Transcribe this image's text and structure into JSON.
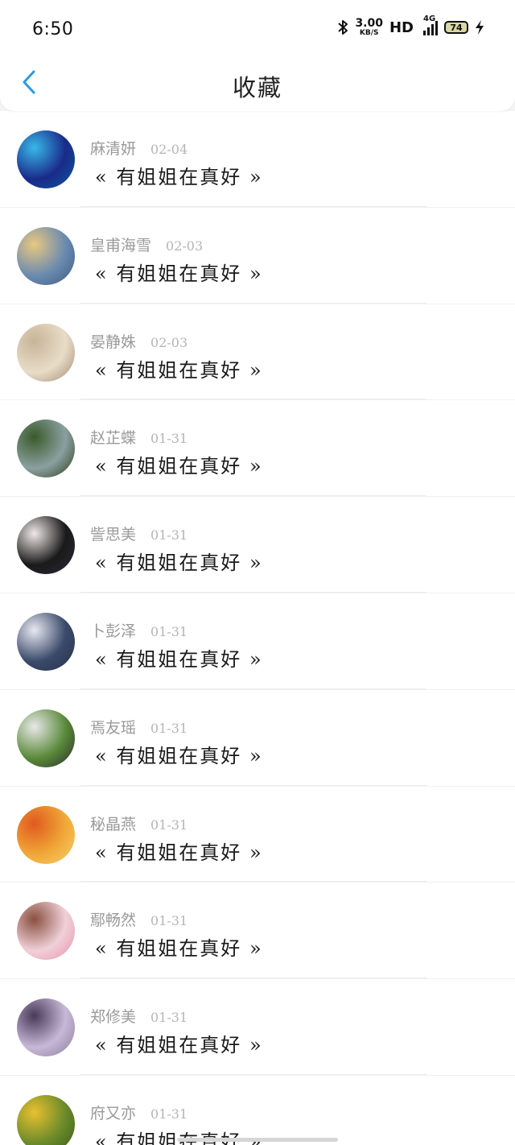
{
  "status_bar": {
    "time": "6:50",
    "speed_value": "3.00",
    "speed_unit": "KB/S",
    "hd": "HD",
    "network": "4G",
    "battery": "74"
  },
  "header": {
    "title": "收藏"
  },
  "items": [
    {
      "name": "麻清妍",
      "date": "02-04",
      "text": "« 有姐姐在真好 »",
      "avatar_colors": [
        "#1a2a8a",
        "#38b8e8",
        "#0a5a9a"
      ]
    },
    {
      "name": "皇甫海雪",
      "date": "02-03",
      "text": "« 有姐姐在真好 »",
      "avatar_colors": [
        "#6a8ab0",
        "#e8c880",
        "#3a5a7a"
      ]
    },
    {
      "name": "晏静姝",
      "date": "02-03",
      "text": "« 有姐姐在真好 »",
      "avatar_colors": [
        "#e8dcc8",
        "#c8b498",
        "#a08a70"
      ]
    },
    {
      "name": "赵芷蝶",
      "date": "01-31",
      "text": "« 有姐姐在真好 »",
      "avatar_colors": [
        "#8aa0a0",
        "#3a5a2a",
        "#2a3a1a"
      ]
    },
    {
      "name": "訾思美",
      "date": "01-31",
      "text": "« 有姐姐在真好 »",
      "avatar_colors": [
        "#1a1a1a",
        "#f0e8e8",
        "#2a2a3a"
      ]
    },
    {
      "name": "卜彭泽",
      "date": "01-31",
      "text": "« 有姐姐在真好 »",
      "avatar_colors": [
        "#3a4a6a",
        "#e8e8f0",
        "#2a3048"
      ]
    },
    {
      "name": "焉友瑶",
      "date": "01-31",
      "text": "« 有姐姐在真好 »",
      "avatar_colors": [
        "#5a8a3a",
        "#e8e8e8",
        "#2a2a2a"
      ]
    },
    {
      "name": "秘晶燕",
      "date": "01-31",
      "text": "« 有姐姐在真好 »",
      "avatar_colors": [
        "#f0a838",
        "#e05a20",
        "#f8d070"
      ]
    },
    {
      "name": "鄢畅然",
      "date": "01-31",
      "text": "« 有姐姐在真好 »",
      "avatar_colors": [
        "#f0d0d8",
        "#8a5040",
        "#e890b0"
      ]
    },
    {
      "name": "郑修美",
      "date": "01-31",
      "text": "« 有姐姐在真好 »",
      "avatar_colors": [
        "#c8b8d8",
        "#4a3a5a",
        "#8a7a9a"
      ]
    },
    {
      "name": "府又亦",
      "date": "01-31",
      "text": "« 有姐姐在真好 »",
      "avatar_colors": [
        "#6a8a2a",
        "#e8c030",
        "#3a5a1a"
      ]
    }
  ],
  "colors": {
    "accent": "#2a9ae8"
  },
  "icons": {
    "back": "chevron-left-icon",
    "bluetooth": "bluetooth-icon",
    "charging": "lightning-icon"
  }
}
